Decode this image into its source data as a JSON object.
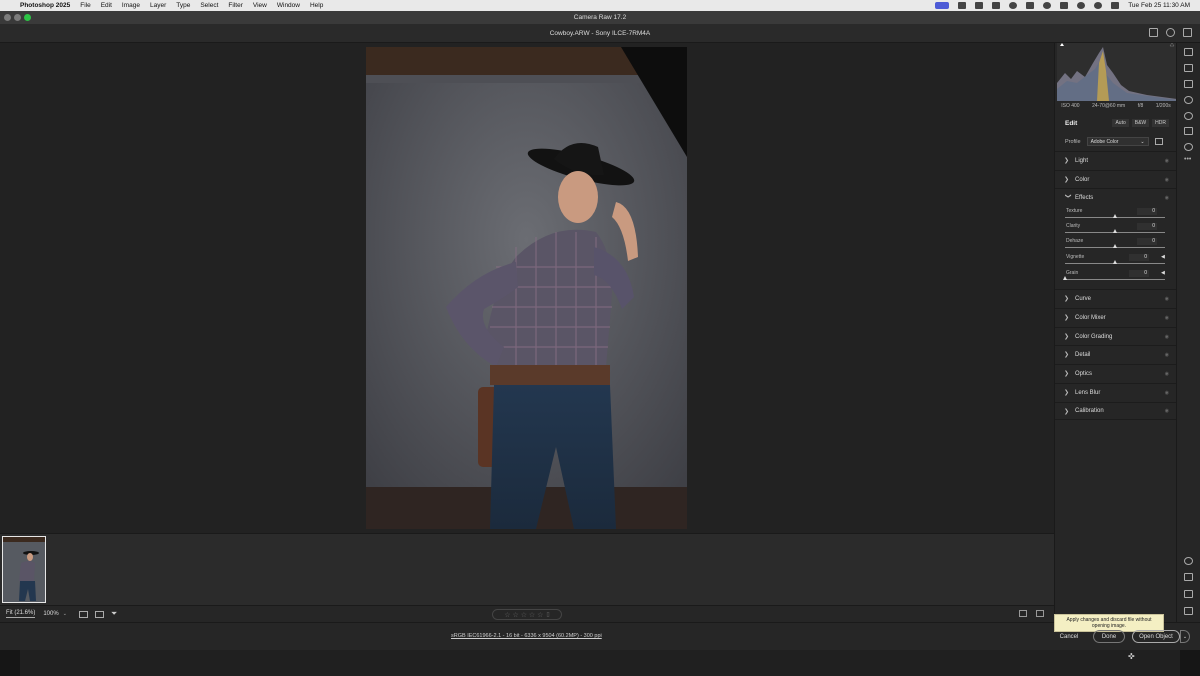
{
  "menubar": {
    "app_name": "Photoshop 2025",
    "items": [
      "File",
      "Edit",
      "Image",
      "Layer",
      "Type",
      "Select",
      "Filter",
      "View",
      "Window",
      "Help"
    ],
    "datetime": "Tue Feb 25  11:30 AM"
  },
  "window": {
    "title": "Camera Raw 17.2"
  },
  "file": {
    "header": "Cowboy.ARW  -  Sony ILCE-7RM4A"
  },
  "exif": {
    "iso": "ISO 400",
    "lens": "24-70@60 mm",
    "aperture": "f/8",
    "shutter": "1/200s"
  },
  "edit_panel": {
    "title": "Edit",
    "tabs": [
      "Auto",
      "B&W",
      "HDR"
    ],
    "profile_label": "Profile",
    "profile_value": "Adobe Color",
    "sections_top": [
      "Light",
      "Color"
    ],
    "effects": {
      "title": "Effects",
      "sliders": [
        {
          "label": "Texture",
          "value": "0",
          "level": 0.5
        },
        {
          "label": "Clarity",
          "value": "0",
          "level": 0.5
        },
        {
          "label": "Dehaze",
          "value": "0",
          "level": 0.5
        },
        {
          "label": "Vignette",
          "value": "0",
          "level": 0.5
        },
        {
          "label": "Grain",
          "value": "0",
          "level": 0.0
        }
      ]
    },
    "sections_bottom": [
      "Curve",
      "Color Mixer",
      "Color Grading",
      "Detail",
      "Optics",
      "Lens Blur",
      "Calibration"
    ]
  },
  "bottombar": {
    "zoom_fit": "Fit (21.6%)",
    "zoom_pct": "100%",
    "rating_stars": "☆ ☆ ☆ ☆ ☆"
  },
  "statusbar": {
    "file_info": "sRGB IEC61966-2.1 - 16 bit - 6336 x 9504 (60.2MP) - 300 ppi",
    "tooltip": "Apply changes and discard file without opening image.",
    "cancel": "Cancel",
    "done": "Done",
    "open": "Open Object"
  },
  "colors": {
    "accent": "#4d5bd6",
    "panel_bg": "#262626",
    "canvas_bg": "#222222"
  }
}
